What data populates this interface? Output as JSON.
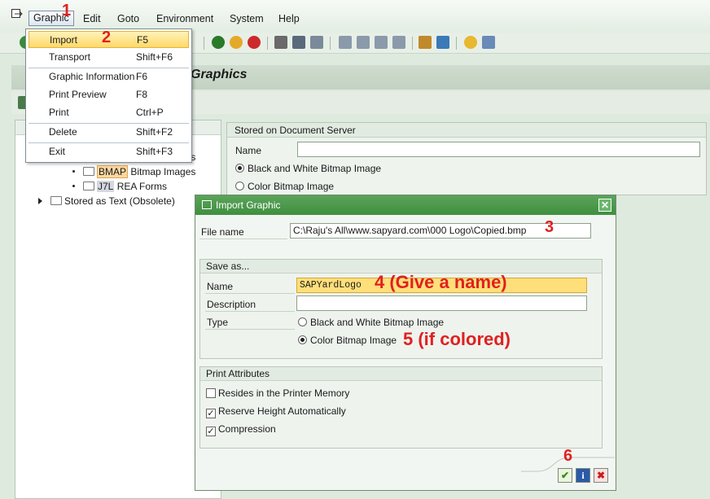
{
  "menubar": {
    "items": [
      "Graphic",
      "Edit",
      "Goto",
      "Environment",
      "System",
      "Help"
    ]
  },
  "graphic_menu": {
    "items": [
      {
        "label": "Import",
        "shortcut": "F5"
      },
      {
        "label": "Transport",
        "shortcut": "Shift+F6"
      },
      {
        "label": "Graphic Information",
        "shortcut": "F6"
      },
      {
        "label": "Print Preview",
        "shortcut": "F8"
      },
      {
        "label": "Print",
        "shortcut": "Ctrl+P"
      },
      {
        "label": "Delete",
        "shortcut": "Shift+F2"
      },
      {
        "label": "Exit",
        "shortcut": "Shift+F3"
      }
    ]
  },
  "titlebar": {
    "title": "Graphics"
  },
  "tree": {
    "partial_text": "hics",
    "bmap_code": "BMAP",
    "bmap_label": "Bitmap Images",
    "j7l_code": "J7L",
    "j7l_label": "REA Forms",
    "stored_text": "Stored as Text (Obsolete)"
  },
  "doc_server": {
    "title": "Stored on Document Server",
    "name_label": "Name",
    "radio_bw": "Black and White Bitmap Image",
    "radio_color": "Color Bitmap Image"
  },
  "dialog": {
    "title": "Import Graphic",
    "close": "✕",
    "file_label": "File name",
    "file_value": "C:\\Raju's All\\www.sapyard.com\\000 Logo\\Copied.bmp",
    "save_as_title": "Save as...",
    "name_label": "Name",
    "name_value": "SAPYardLogo",
    "description_label": "Description",
    "description_value": "",
    "type_label": "Type",
    "radio_bw": "Black and White Bitmap Image",
    "radio_color": "Color Bitmap Image",
    "print_title": "Print Attributes",
    "cb_printer": "Resides in the Printer Memory",
    "cb_reserve": "Reserve Height Automatically",
    "cb_compression": "Compression",
    "check_printer": "",
    "check_reserve": "✓",
    "check_compression": "✓",
    "btn_ok": "✔",
    "btn_info": "i",
    "btn_cancel": "✖"
  },
  "annotations": {
    "a1": "1",
    "a2": "2",
    "a3": "3",
    "a4": "4 (Give a name)",
    "a5": "5 (if colored)",
    "a6": "6"
  },
  "colors": {
    "accent_green": "#3f8f3f",
    "annotation_red": "#e02020",
    "highlight": "#ffd86a"
  }
}
